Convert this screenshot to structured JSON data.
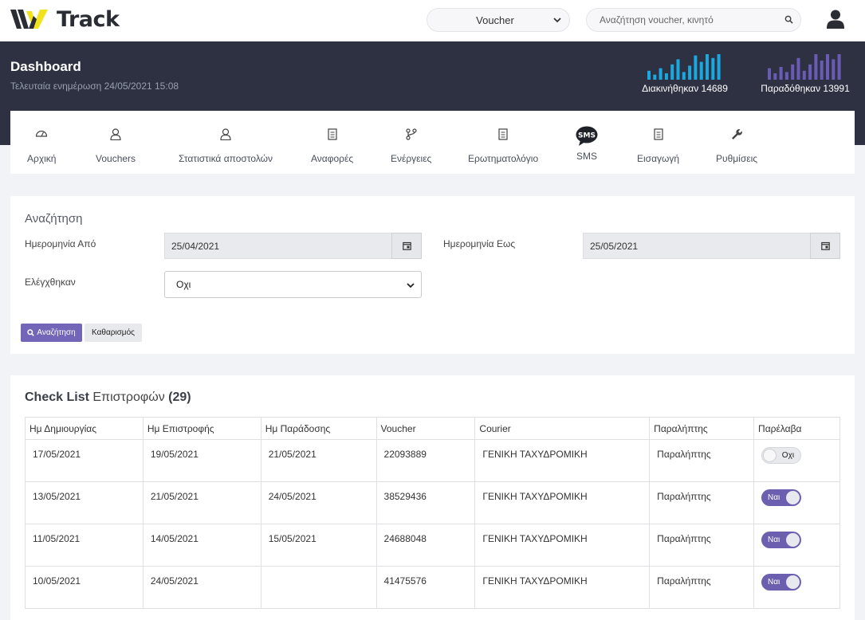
{
  "brand": {
    "name": "Track",
    "accent": "#f2e21b"
  },
  "topbar": {
    "type_select_value": "Voucher",
    "search_placeholder": "Αναζήτηση voucher, κινητό"
  },
  "header": {
    "title": "Dashboard",
    "subtitle": "Τελευταία ενημέρωση 24/05/2021 15:08",
    "stats": [
      {
        "label": "Διακινήθηκαν 14689",
        "color": "#1ba8e0",
        "bars": [
          0.35,
          0.2,
          0.45,
          0.25,
          0.6,
          0.8,
          0.3,
          0.55,
          0.95,
          0.7,
          1.0,
          0.85,
          1.0
        ]
      },
      {
        "label": "Παραδόθηκαν 13991",
        "color": "#6a5bb5",
        "bars": [
          0.45,
          0.25,
          0.5,
          0.3,
          0.6,
          0.85,
          0.35,
          0.6,
          1.0,
          0.75,
          1.0,
          0.8,
          1.0
        ]
      }
    ]
  },
  "nav": {
    "items": [
      {
        "label": "Αρχική",
        "icon": "dashboard-gauge-icon"
      },
      {
        "label": "Vouchers",
        "icon": "user-outline-icon"
      },
      {
        "label": "Στατιστικά αποστολών",
        "icon": "user-outline-icon"
      },
      {
        "label": "Αναφορές",
        "icon": "receipt-icon"
      },
      {
        "label": "Ενέργειες",
        "icon": "branch-icon"
      },
      {
        "label": "Ερωτηματολόγιο",
        "icon": "receipt-icon"
      },
      {
        "label": "SMS",
        "icon": "sms-bubble-icon"
      },
      {
        "label": "Εισαγωγή",
        "icon": "receipt-icon"
      },
      {
        "label": "Ρυθμίσεις",
        "icon": "wrench-icon"
      }
    ]
  },
  "search": {
    "title": "Αναζήτηση",
    "date_from_label": "Ημερομηνία Από",
    "date_from_value": "25/04/2021",
    "date_to_label": "Ημερομηνία Εως",
    "date_to_value": "25/05/2021",
    "checked_label": "Ελέγχθηκαν",
    "checked_value": "Οχι",
    "search_button": "Αναζήτηση",
    "clear_button": "Καθαρισμός"
  },
  "checklist": {
    "title_bold": "Check List",
    "title_rest": "Επιστροφών",
    "count": "(29)",
    "columns": [
      "Ημ Δημιουργίας",
      "Ημ Επιστροφής",
      "Ημ Παράδοσης",
      "Voucher",
      "Courier",
      "Παραλήπτης",
      "Παρέλαβα"
    ],
    "rows": [
      {
        "created": "17/05/2021",
        "returned": "19/05/2021",
        "delivered": "21/05/2021",
        "voucher": "22093889",
        "courier": "ΓΕΝΙΚΗ ΤΑΧΥΔΡΟΜΙΚΗ",
        "recipient": "Παραλήπτης",
        "received": false,
        "received_label": "Οχι"
      },
      {
        "created": "13/05/2021",
        "returned": "21/05/2021",
        "delivered": "24/05/2021",
        "voucher": "38529436",
        "courier": "ΓΕΝΙΚΗ ΤΑΧΥΔΡΟΜΙΚΗ",
        "recipient": "Παραλήπτης",
        "received": true,
        "received_label": "Ναι"
      },
      {
        "created": "11/05/2021",
        "returned": "14/05/2021",
        "delivered": "15/05/2021",
        "voucher": "24688048",
        "courier": "ΓΕΝΙΚΗ ΤΑΧΥΔΡΟΜΙΚΗ",
        "recipient": "Παραλήπτης",
        "received": true,
        "received_label": "Ναι"
      },
      {
        "created": "10/05/2021",
        "returned": "24/05/2021",
        "delivered": "",
        "voucher": "41475576",
        "courier": "ΓΕΝΙΚΗ ΤΑΧΥΔΡΟΜΙΚΗ",
        "recipient": "Παραλήπτης",
        "received": true,
        "received_label": "Ναι"
      }
    ]
  }
}
